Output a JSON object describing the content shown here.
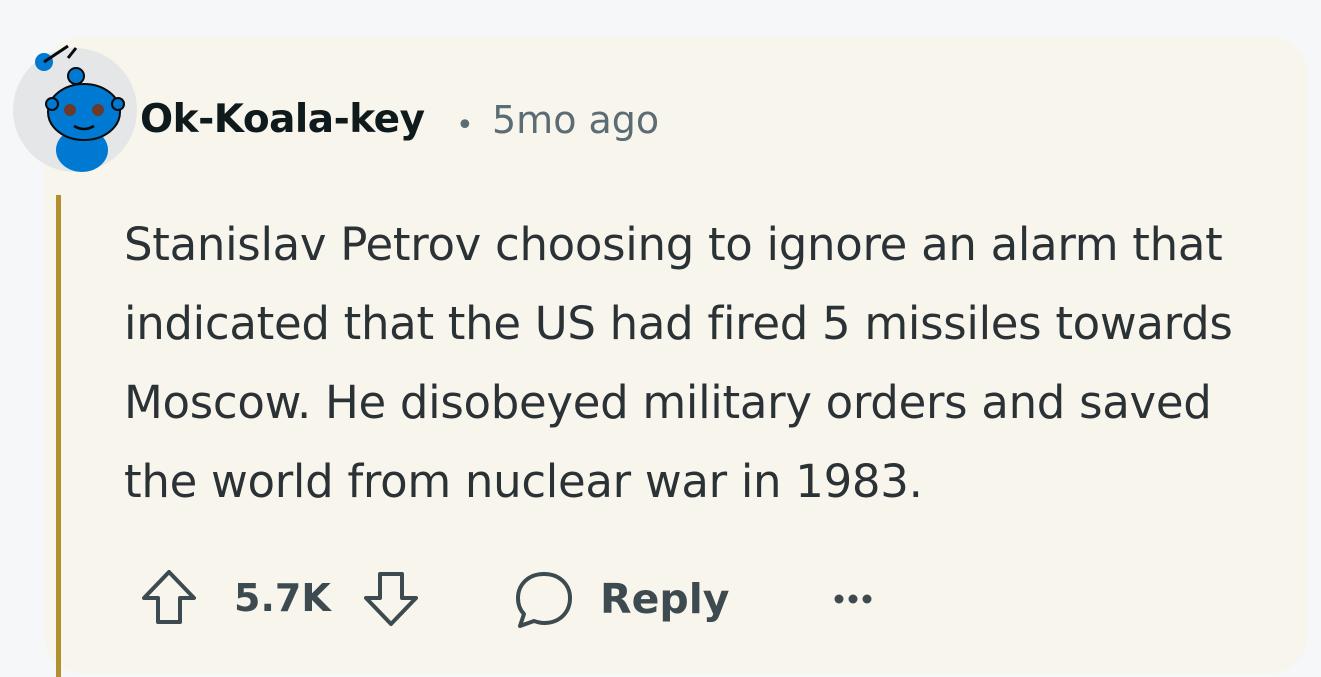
{
  "comment": {
    "author": "Ok-Koala-key",
    "separator": "•",
    "time_ago": "5mo ago",
    "body": "Stanislav Petrov choosing to ignore an alarm that indicated that the US had fired 5 missiles towards Moscow. He disobeyed military orders and saved the world from nuclear war in 1983.",
    "score": "5.7K",
    "reply_label": "Reply"
  },
  "icons": {
    "avatar": "snoo-avatar-icon",
    "upvote": "upvote-arrow-icon",
    "downvote": "downvote-arrow-icon",
    "reply": "speech-bubble-icon",
    "more": "ellipsis-icon"
  },
  "colors": {
    "card_background": "#f8f5ed",
    "thread_line": "#b48f2f",
    "text_primary": "#2a3236",
    "text_muted": "#5c6c74",
    "avatar_blue": "#0079d3"
  }
}
